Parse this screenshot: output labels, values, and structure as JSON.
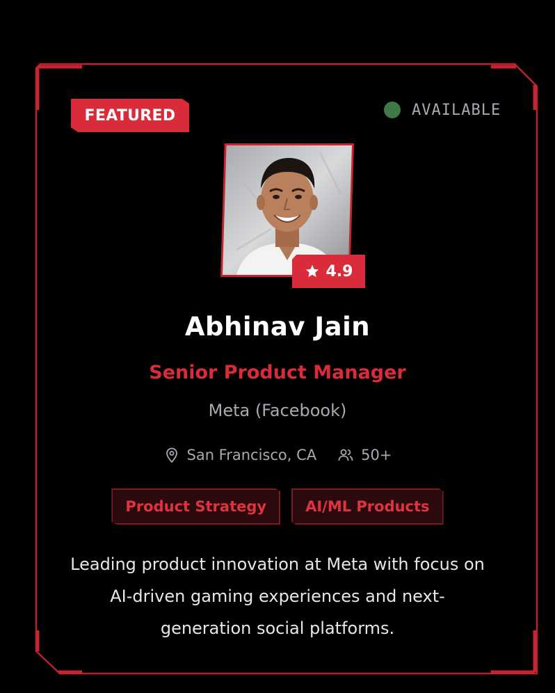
{
  "badge": {
    "featured": "FEATURED"
  },
  "status": {
    "label": "AVAILABLE",
    "color": "#3f7a46"
  },
  "profile": {
    "photo_alt": "profile-photo",
    "rating": "4.9",
    "name": "Abhinav Jain",
    "role": "Senior Product Manager",
    "company": "Meta (Facebook)",
    "location": "San Francisco, CA",
    "connections": "50+",
    "tags": [
      "Product Strategy",
      "AI/ML Products"
    ],
    "description": "Leading product innovation at Meta with focus on AI-driven gaming experiences and next-generation social platforms."
  },
  "theme": {
    "accent": "#d92b3a",
    "background": "#000000",
    "muted": "#a7aab3"
  },
  "icons": {
    "rating": "star-icon",
    "location": "map-pin-icon",
    "connections": "users-icon"
  }
}
